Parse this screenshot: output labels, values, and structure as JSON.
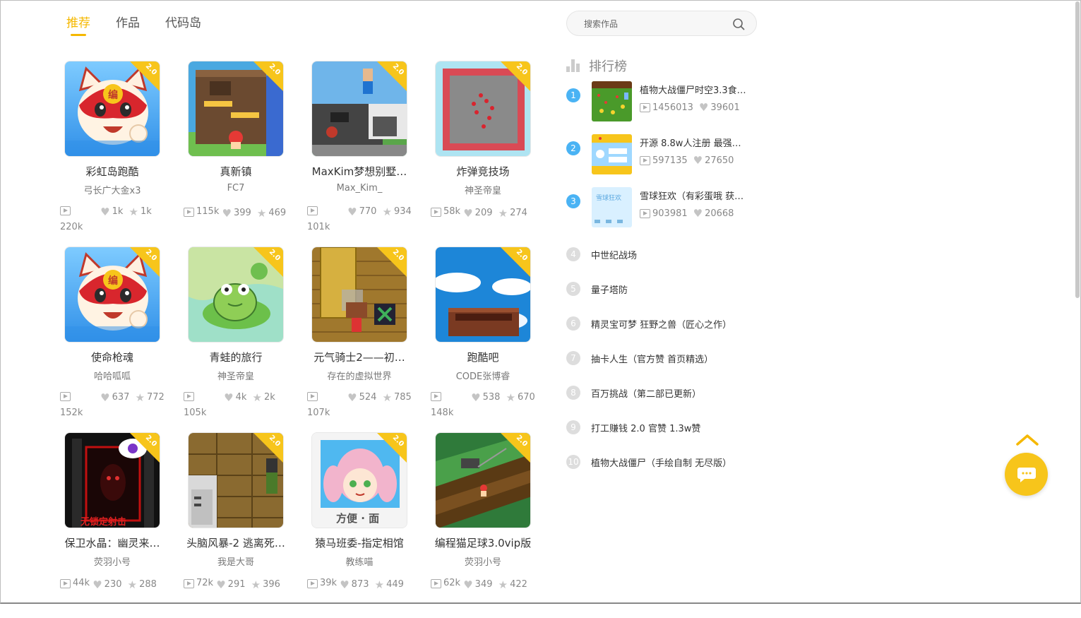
{
  "tabs": [
    {
      "label": "推荐",
      "active": true
    },
    {
      "label": "作品",
      "active": false
    },
    {
      "label": "代码岛",
      "active": false
    }
  ],
  "search": {
    "placeholder": "搜索作品"
  },
  "badge_label": "2.0",
  "works": [
    {
      "title": "彩虹岛跑酷",
      "author": "弓长广大金x3",
      "views": "220k",
      "likes": "1k",
      "stars": "1k",
      "thumb": "cat",
      "views_wrap": true
    },
    {
      "title": "真新镇",
      "author": "FC7",
      "views": "115k",
      "likes": "399",
      "stars": "469",
      "thumb": "house",
      "views_wrap": false
    },
    {
      "title": "MaxKim梦想别墅…",
      "author": "Max_Kim_",
      "views": "101k",
      "likes": "770",
      "stars": "934",
      "thumb": "villa",
      "views_wrap": true
    },
    {
      "title": "炸弹竞技场",
      "author": "神圣帝皇",
      "views": "58k",
      "likes": "209",
      "stars": "274",
      "thumb": "arena",
      "views_wrap": false
    },
    {
      "title": "使命枪魂",
      "author": "哈哈呱呱",
      "views": "152k",
      "likes": "637",
      "stars": "772",
      "thumb": "cat",
      "views_wrap": true
    },
    {
      "title": "青蛙的旅行",
      "author": "神圣帝皇",
      "views": "105k",
      "likes": "4k",
      "stars": "2k",
      "thumb": "frog",
      "views_wrap": true
    },
    {
      "title": "元气骑士2——初…",
      "author": "存在的虚拟世界",
      "views": "107k",
      "likes": "524",
      "stars": "785",
      "thumb": "knight",
      "views_wrap": true
    },
    {
      "title": "跑酷吧",
      "author": "CODE张博睿",
      "views": "148k",
      "likes": "538",
      "stars": "670",
      "thumb": "sky",
      "views_wrap": true
    },
    {
      "title": "保卫水晶：幽灵来…",
      "author": "荧羽小号",
      "views": "44k",
      "likes": "230",
      "stars": "288",
      "thumb": "ghost",
      "views_wrap": false
    },
    {
      "title": "头脑风暴-2 逃离死…",
      "author": "我是大哥",
      "views": "72k",
      "likes": "291",
      "stars": "396",
      "thumb": "room",
      "views_wrap": false
    },
    {
      "title": "猿马班委-指定相馆",
      "author": "教练喵",
      "views": "39k",
      "likes": "873",
      "stars": "449",
      "thumb": "girl",
      "views_wrap": false
    },
    {
      "title": "编程猫足球3.0vip版",
      "author": "荧羽小号",
      "views": "62k",
      "likes": "349",
      "stars": "422",
      "thumb": "soccer",
      "views_wrap": false
    }
  ],
  "ranking": {
    "title": "排行榜",
    "top": [
      {
        "num": "1",
        "name": "植物大战僵尸时空3.3食…",
        "views": "1456013",
        "likes": "39601",
        "thumb": "pvz"
      },
      {
        "num": "2",
        "name": "开源 8.8w人注册 最强…",
        "views": "597135",
        "likes": "27650",
        "thumb": "login"
      },
      {
        "num": "3",
        "name": "雪球狂欢（有彩蛋哦 获…",
        "views": "903981",
        "likes": "20668",
        "thumb": "snow"
      }
    ],
    "rest": [
      {
        "num": "4",
        "name": "中世纪战场"
      },
      {
        "num": "5",
        "name": "量子塔防"
      },
      {
        "num": "6",
        "name": "精灵宝可梦 狂野之兽（匠心之作）"
      },
      {
        "num": "7",
        "name": "抽卡人生（官方赞 首页精选）"
      },
      {
        "num": "8",
        "name": "百万挑战（第二部已更新）"
      },
      {
        "num": "9",
        "name": "打工赚钱 2.0 官赞 1.3w赞"
      },
      {
        "num": "10",
        "name": "植物大战僵尸（手绘自制 无尽版）"
      }
    ]
  },
  "colors": {
    "accent": "#f5b800",
    "badge": "#f7c51b",
    "rank_blue": "#4ab3f4"
  }
}
